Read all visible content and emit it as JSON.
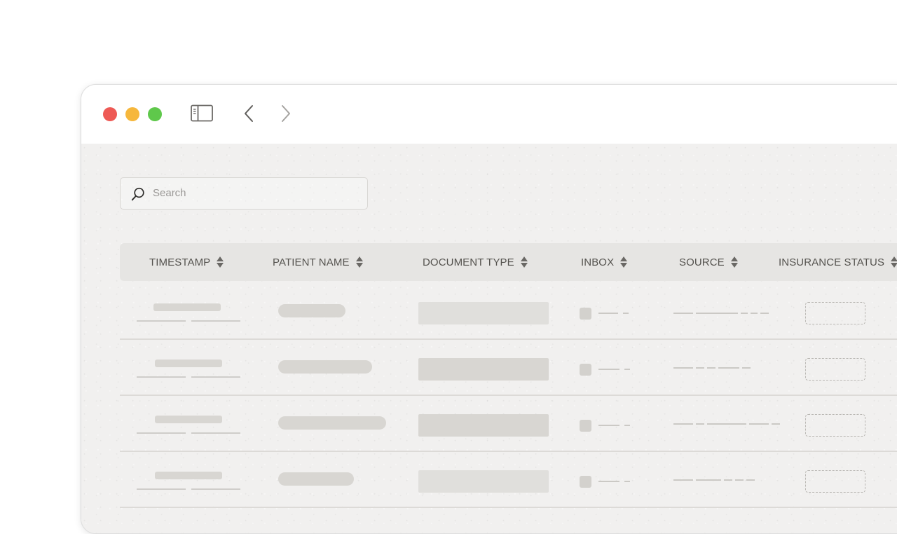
{
  "window": {
    "toolbar": {
      "sidebar_icon": "sidebar-icon",
      "back_icon": "chevron-left-icon",
      "forward_icon": "chevron-right-icon"
    }
  },
  "search": {
    "placeholder": "Search",
    "value": "",
    "icon": "search-icon"
  },
  "table": {
    "columns": [
      {
        "label": "TIMESTAMP",
        "sort_icon": "sort-icon"
      },
      {
        "label": "PATIENT NAME",
        "sort_icon": "sort-icon"
      },
      {
        "label": "DOCUMENT TYPE",
        "sort_icon": "sort-icon"
      },
      {
        "label": "INBOX",
        "sort_icon": "sort-icon"
      },
      {
        "label": "SOURCE",
        "sort_icon": "sort-icon"
      },
      {
        "label": "INSURANCE STATUS",
        "sort_icon": "sort-icon"
      }
    ],
    "rows_visible": 4,
    "rows_content": "placeholder skeletons"
  },
  "colors": {
    "close": "#ee5a55",
    "minimize": "#f6b73c",
    "maximize": "#5fc84b",
    "content_bg": "#f1f0ef",
    "header_bg": "#e6e5e3"
  }
}
